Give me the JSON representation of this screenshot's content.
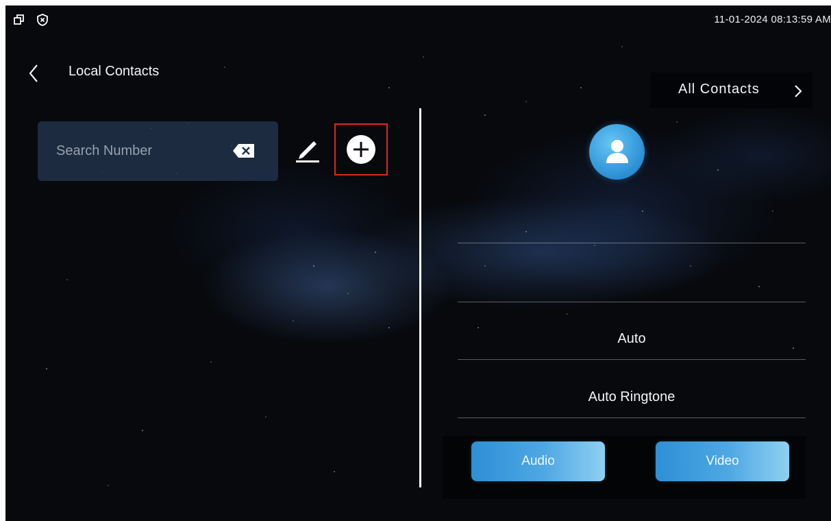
{
  "status_bar": {
    "icons": [
      "window-restore-icon",
      "shield-close-icon"
    ],
    "datetime": "11-01-2024 08:13:59 AM"
  },
  "header": {
    "back_icon": "chevron-left-icon",
    "title": "Local Contacts"
  },
  "search": {
    "placeholder": "Search Number",
    "value": "",
    "clear_icon": "backspace-clear-icon"
  },
  "toolbar": {
    "edit_icon": "pencil-edit-icon",
    "add_icon": "plus-circle-icon",
    "highlight_color": "#e0261f"
  },
  "filter": {
    "label": "All Contacts",
    "icon": "chevron-right-icon"
  },
  "contact_detail": {
    "avatar_icon": "person-avatar-icon",
    "name": "",
    "number": "",
    "device_setting": "Auto",
    "ringtone": "Auto Ringtone"
  },
  "actions": {
    "audio_label": "Audio",
    "video_label": "Video"
  },
  "colors": {
    "background": "#07090d",
    "accent": "#2d8fd6",
    "accent_light": "#8fd0f2",
    "text": "#f2f4f7"
  }
}
